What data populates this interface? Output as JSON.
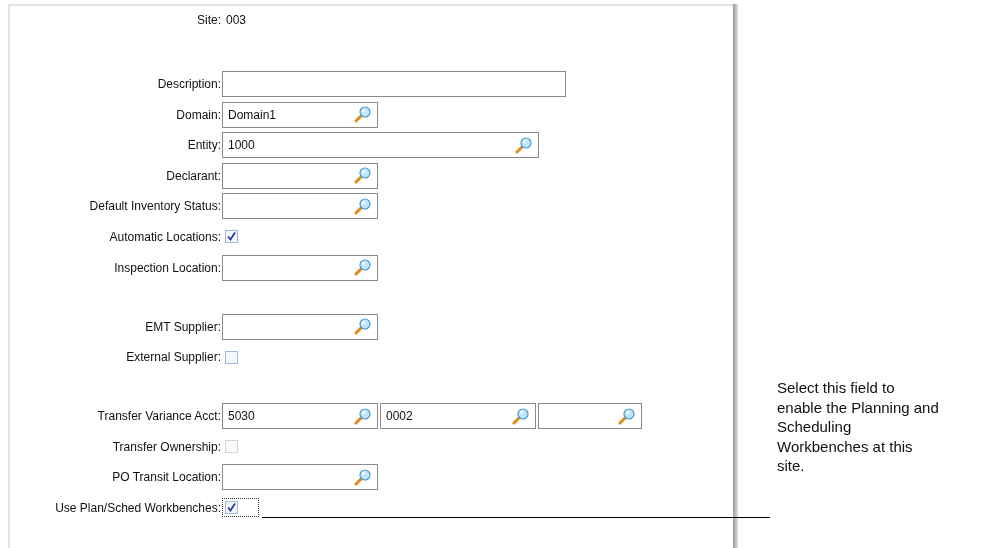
{
  "sections": [
    {
      "rows": [
        {
          "kind": "static",
          "label": "Site:",
          "value": "003"
        }
      ]
    },
    {
      "rows": [
        {
          "kind": "fields",
          "label": "Description:",
          "inputs": [
            {
              "kind": "wide_text"
            }
          ]
        },
        {
          "kind": "fields",
          "label": "Domain:",
          "inputs": [
            {
              "kind": "lookup",
              "value": "Domain1"
            }
          ]
        },
        {
          "kind": "fields",
          "label": "Entity:",
          "inputs": [
            {
              "kind": "long_lookup",
              "value": "1000"
            }
          ]
        },
        {
          "kind": "fields",
          "label": "Declarant:",
          "inputs": [
            {
              "kind": "lookup"
            }
          ]
        },
        {
          "kind": "fields",
          "label": "Default Inventory Status:",
          "inputs": [
            {
              "kind": "lookup"
            }
          ]
        },
        {
          "kind": "checkbox",
          "label": "Automatic Locations:",
          "checked": true,
          "disabled": false,
          "focused": false
        },
        {
          "kind": "fields",
          "label": "Inspection Location:",
          "inputs": [
            {
              "kind": "lookup"
            }
          ]
        }
      ]
    },
    {
      "rows": [
        {
          "kind": "fields",
          "label": "EMT Supplier:",
          "inputs": [
            {
              "kind": "lookup"
            }
          ]
        },
        {
          "kind": "checkbox",
          "label": "External Supplier:",
          "checked": false,
          "disabled": false,
          "focused": false
        }
      ]
    },
    {
      "rows": [
        {
          "kind": "fields",
          "label": "Transfer Variance Acct:",
          "inputs": [
            {
              "kind": "lookup",
              "value": "5030"
            },
            {
              "kind": "lookup",
              "value": "0002"
            },
            {
              "kind": "short_lookup"
            }
          ]
        },
        {
          "kind": "checkbox",
          "label": "Transfer Ownership:",
          "checked": false,
          "disabled": true,
          "focused": false
        },
        {
          "kind": "fields",
          "label": "PO Transit Location:",
          "inputs": [
            {
              "kind": "lookup"
            }
          ]
        },
        {
          "kind": "checkbox",
          "label": "Use Plan/Sched Workbenches:",
          "checked": true,
          "disabled": false,
          "focused": true
        }
      ]
    }
  ],
  "callout": {
    "lines": [
      "Select this field to",
      "enable the Planning and",
      "Scheduling",
      "Workbenches at this",
      "site."
    ]
  }
}
